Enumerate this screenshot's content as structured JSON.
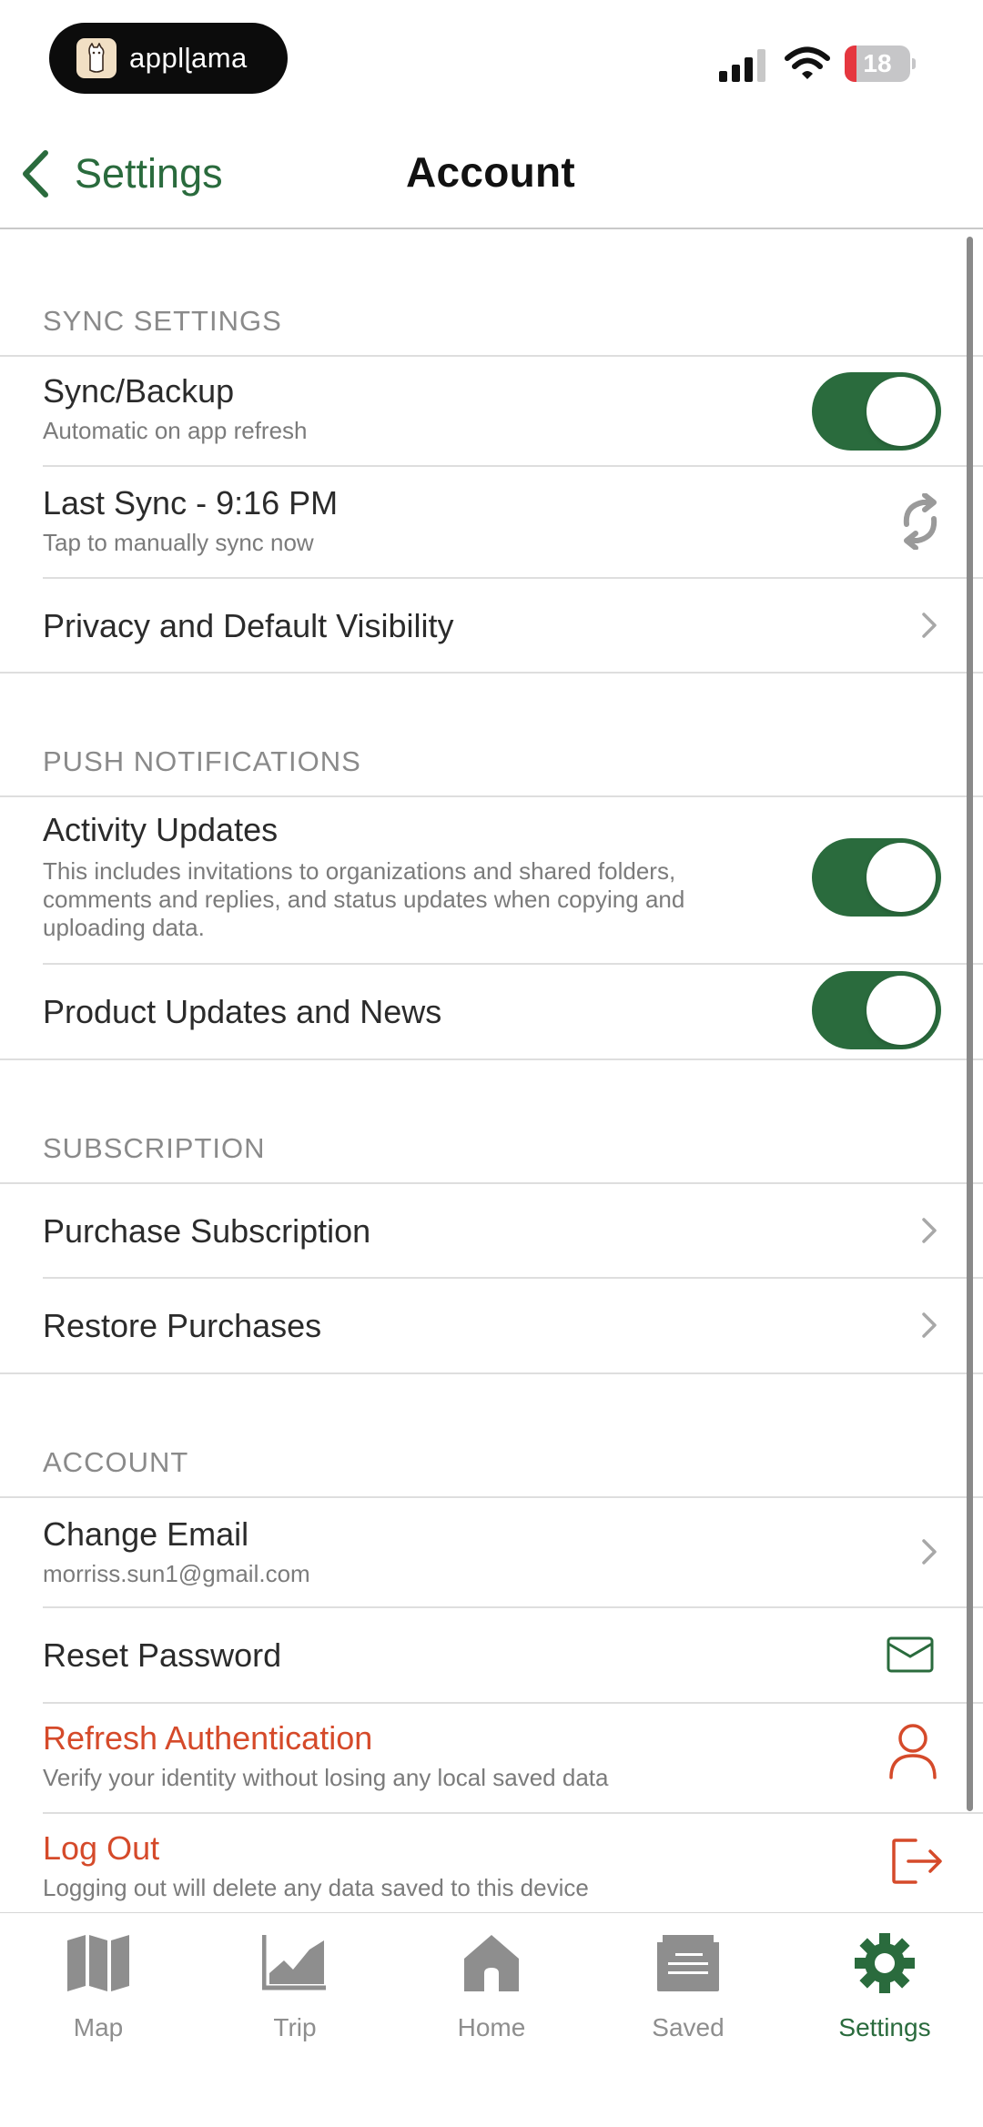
{
  "status_bar": {
    "app_name": "applɭama",
    "battery_level": "18",
    "battery_fraction": 0.18
  },
  "nav": {
    "back_label": "Settings",
    "title": "Account"
  },
  "sections": {
    "sync": {
      "header": "SYNC SETTINGS",
      "sync_backup": {
        "title": "Sync/Backup",
        "subtitle": "Automatic on app refresh",
        "enabled": true
      },
      "last_sync": {
        "title": "Last Sync - 9:16 PM",
        "subtitle": "Tap to manually sync now"
      },
      "privacy": {
        "title": "Privacy and Default Visibility"
      }
    },
    "push": {
      "header": "PUSH NOTIFICATIONS",
      "activity": {
        "title": "Activity Updates",
        "subtitle_1": "This includes invitations to organizations and shared folders,",
        "subtitle_2": "comments and replies, and status updates when copying and",
        "subtitle_3": "uploading data.",
        "enabled": true
      },
      "product": {
        "title": "Product Updates and News",
        "enabled": true
      }
    },
    "subscription": {
      "header": "SUBSCRIPTION",
      "purchase": {
        "title": "Purchase Subscription"
      },
      "restore": {
        "title": "Restore Purchases"
      }
    },
    "account": {
      "header": "ACCOUNT",
      "change_email": {
        "title": "Change Email",
        "subtitle": "morriss.sun1@gmail.com"
      },
      "reset_password": {
        "title": "Reset Password"
      },
      "refresh_auth": {
        "title": "Refresh Authentication",
        "subtitle": "Verify your identity without losing any local saved data"
      },
      "log_out": {
        "title": "Log Out",
        "subtitle": "Logging out will delete any data saved to this device"
      }
    }
  },
  "tabs": [
    {
      "label": "Map",
      "icon": "map-icon",
      "active": false
    },
    {
      "label": "Trip",
      "icon": "chart-icon",
      "active": false
    },
    {
      "label": "Home",
      "icon": "home-icon",
      "active": false
    },
    {
      "label": "Saved",
      "icon": "saved-icon",
      "active": false
    },
    {
      "label": "Settings",
      "icon": "gear-icon",
      "active": true
    }
  ],
  "colors": {
    "accent_green": "#2a6b3d",
    "danger_orange": "#d54a2a",
    "header_gray": "#8a8a8a",
    "battery_red": "#e5373f"
  }
}
